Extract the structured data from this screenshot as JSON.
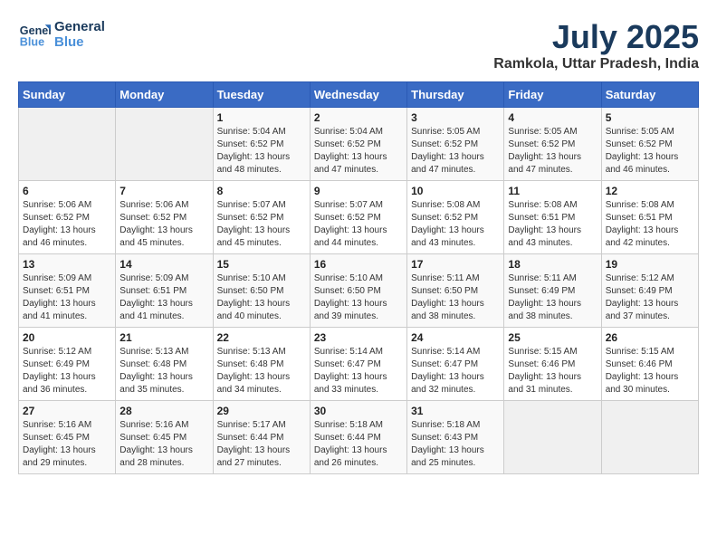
{
  "logo": {
    "line1": "General",
    "line2": "Blue"
  },
  "title": "July 2025",
  "subtitle": "Ramkola, Uttar Pradesh, India",
  "weekdays": [
    "Sunday",
    "Monday",
    "Tuesday",
    "Wednesday",
    "Thursday",
    "Friday",
    "Saturday"
  ],
  "weeks": [
    [
      {
        "day": "",
        "info": ""
      },
      {
        "day": "",
        "info": ""
      },
      {
        "day": "1",
        "info": "Sunrise: 5:04 AM\nSunset: 6:52 PM\nDaylight: 13 hours and 48 minutes."
      },
      {
        "day": "2",
        "info": "Sunrise: 5:04 AM\nSunset: 6:52 PM\nDaylight: 13 hours and 47 minutes."
      },
      {
        "day": "3",
        "info": "Sunrise: 5:05 AM\nSunset: 6:52 PM\nDaylight: 13 hours and 47 minutes."
      },
      {
        "day": "4",
        "info": "Sunrise: 5:05 AM\nSunset: 6:52 PM\nDaylight: 13 hours and 47 minutes."
      },
      {
        "day": "5",
        "info": "Sunrise: 5:05 AM\nSunset: 6:52 PM\nDaylight: 13 hours and 46 minutes."
      }
    ],
    [
      {
        "day": "6",
        "info": "Sunrise: 5:06 AM\nSunset: 6:52 PM\nDaylight: 13 hours and 46 minutes."
      },
      {
        "day": "7",
        "info": "Sunrise: 5:06 AM\nSunset: 6:52 PM\nDaylight: 13 hours and 45 minutes."
      },
      {
        "day": "8",
        "info": "Sunrise: 5:07 AM\nSunset: 6:52 PM\nDaylight: 13 hours and 45 minutes."
      },
      {
        "day": "9",
        "info": "Sunrise: 5:07 AM\nSunset: 6:52 PM\nDaylight: 13 hours and 44 minutes."
      },
      {
        "day": "10",
        "info": "Sunrise: 5:08 AM\nSunset: 6:52 PM\nDaylight: 13 hours and 43 minutes."
      },
      {
        "day": "11",
        "info": "Sunrise: 5:08 AM\nSunset: 6:51 PM\nDaylight: 13 hours and 43 minutes."
      },
      {
        "day": "12",
        "info": "Sunrise: 5:08 AM\nSunset: 6:51 PM\nDaylight: 13 hours and 42 minutes."
      }
    ],
    [
      {
        "day": "13",
        "info": "Sunrise: 5:09 AM\nSunset: 6:51 PM\nDaylight: 13 hours and 41 minutes."
      },
      {
        "day": "14",
        "info": "Sunrise: 5:09 AM\nSunset: 6:51 PM\nDaylight: 13 hours and 41 minutes."
      },
      {
        "day": "15",
        "info": "Sunrise: 5:10 AM\nSunset: 6:50 PM\nDaylight: 13 hours and 40 minutes."
      },
      {
        "day": "16",
        "info": "Sunrise: 5:10 AM\nSunset: 6:50 PM\nDaylight: 13 hours and 39 minutes."
      },
      {
        "day": "17",
        "info": "Sunrise: 5:11 AM\nSunset: 6:50 PM\nDaylight: 13 hours and 38 minutes."
      },
      {
        "day": "18",
        "info": "Sunrise: 5:11 AM\nSunset: 6:49 PM\nDaylight: 13 hours and 38 minutes."
      },
      {
        "day": "19",
        "info": "Sunrise: 5:12 AM\nSunset: 6:49 PM\nDaylight: 13 hours and 37 minutes."
      }
    ],
    [
      {
        "day": "20",
        "info": "Sunrise: 5:12 AM\nSunset: 6:49 PM\nDaylight: 13 hours and 36 minutes."
      },
      {
        "day": "21",
        "info": "Sunrise: 5:13 AM\nSunset: 6:48 PM\nDaylight: 13 hours and 35 minutes."
      },
      {
        "day": "22",
        "info": "Sunrise: 5:13 AM\nSunset: 6:48 PM\nDaylight: 13 hours and 34 minutes."
      },
      {
        "day": "23",
        "info": "Sunrise: 5:14 AM\nSunset: 6:47 PM\nDaylight: 13 hours and 33 minutes."
      },
      {
        "day": "24",
        "info": "Sunrise: 5:14 AM\nSunset: 6:47 PM\nDaylight: 13 hours and 32 minutes."
      },
      {
        "day": "25",
        "info": "Sunrise: 5:15 AM\nSunset: 6:46 PM\nDaylight: 13 hours and 31 minutes."
      },
      {
        "day": "26",
        "info": "Sunrise: 5:15 AM\nSunset: 6:46 PM\nDaylight: 13 hours and 30 minutes."
      }
    ],
    [
      {
        "day": "27",
        "info": "Sunrise: 5:16 AM\nSunset: 6:45 PM\nDaylight: 13 hours and 29 minutes."
      },
      {
        "day": "28",
        "info": "Sunrise: 5:16 AM\nSunset: 6:45 PM\nDaylight: 13 hours and 28 minutes."
      },
      {
        "day": "29",
        "info": "Sunrise: 5:17 AM\nSunset: 6:44 PM\nDaylight: 13 hours and 27 minutes."
      },
      {
        "day": "30",
        "info": "Sunrise: 5:18 AM\nSunset: 6:44 PM\nDaylight: 13 hours and 26 minutes."
      },
      {
        "day": "31",
        "info": "Sunrise: 5:18 AM\nSunset: 6:43 PM\nDaylight: 13 hours and 25 minutes."
      },
      {
        "day": "",
        "info": ""
      },
      {
        "day": "",
        "info": ""
      }
    ]
  ]
}
